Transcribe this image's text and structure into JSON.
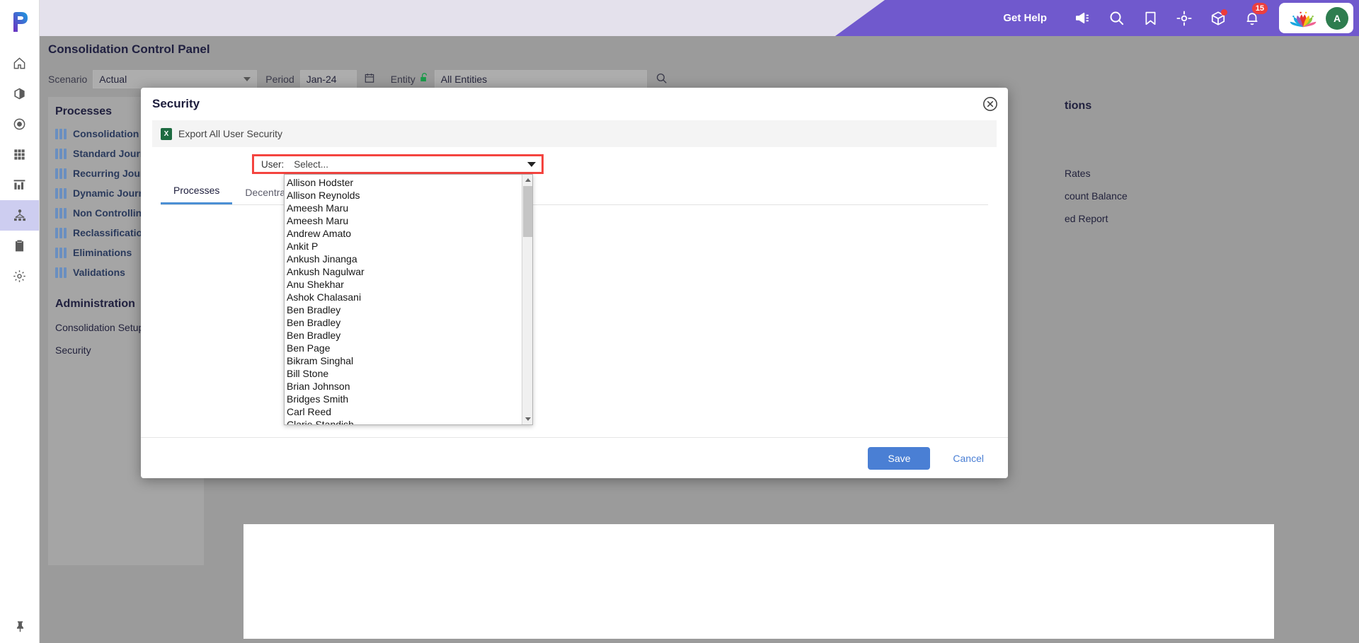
{
  "app": {
    "logo": "p-logo",
    "accent_purple": "#7059cd",
    "accent_blue": "#4a7fd4",
    "highlight_red": "#f4443f"
  },
  "rail": {
    "items": [
      {
        "icon": "home-icon",
        "name": "home",
        "active": false
      },
      {
        "icon": "cube-icon",
        "name": "models",
        "active": false
      },
      {
        "icon": "target-circle-icon",
        "name": "targets",
        "active": false
      },
      {
        "icon": "grid-icon",
        "name": "grid",
        "active": false
      },
      {
        "icon": "bar-chart-icon",
        "name": "reports",
        "active": false
      },
      {
        "icon": "hierarchy-icon",
        "name": "consolidation",
        "active": true
      },
      {
        "icon": "clipboard-check-icon",
        "name": "tasks",
        "active": false
      },
      {
        "icon": "gear-icon",
        "name": "settings",
        "active": false
      }
    ],
    "pin": "pin-icon"
  },
  "topbar": {
    "get_help": "Get Help",
    "icons": [
      {
        "name": "megaphone-icon",
        "badge": null,
        "dot": false
      },
      {
        "name": "search-icon",
        "badge": null,
        "dot": false
      },
      {
        "name": "bookmark-icon",
        "badge": null,
        "dot": false
      },
      {
        "name": "crosshair-icon",
        "badge": null,
        "dot": false
      },
      {
        "name": "box-icon",
        "badge": null,
        "dot": true
      },
      {
        "name": "bell-icon",
        "badge": "15",
        "dot": false
      }
    ],
    "brand_logo": "lotus-logo",
    "avatar_initial": "A"
  },
  "page": {
    "title": "Consolidation Control Panel",
    "filters": {
      "scenario_label": "Scenario",
      "scenario_value": "Actual",
      "period_label": "Period",
      "period_value": "Jan-24",
      "period_icon": "calendar-icon",
      "entity_label": "Entity",
      "entity_lock_icon": "unlock-icon",
      "entity_value": "All Entities",
      "search_icon": "search-icon"
    },
    "left_panel": {
      "processes_heading": "Processes",
      "processes": [
        "Consolidation Pro",
        "Standard Journal",
        "Recurring Journa",
        "Dynamic Journals",
        "Non Controlling",
        "Reclassifications",
        "Eliminations",
        "Validations"
      ],
      "administration_heading": "Administration",
      "administration": [
        "Consolidation Setup",
        "Security"
      ]
    },
    "right_panel": {
      "heading": "tions",
      "items": [
        "Rates",
        "count Balance",
        "ed Report"
      ]
    }
  },
  "modal": {
    "title": "Security",
    "close_icon": "close-icon",
    "export": {
      "icon": "excel-icon",
      "icon_text": "X",
      "label": "Export All User Security"
    },
    "user_field": {
      "label": "User:",
      "value": "Select...",
      "caret_icon": "chevron-down-icon"
    },
    "tabs": [
      {
        "label": "Processes",
        "active": true
      },
      {
        "label": "Decentralize",
        "active": false
      }
    ],
    "dropdown": {
      "options": [
        "Allison Hodster",
        "Allison Reynolds",
        "Ameesh Maru",
        "Ameesh Maru",
        "Andrew Amato",
        "Ankit P",
        "Ankush Jinanga",
        "Ankush Nagulwar",
        "Anu Shekhar",
        "Ashok Chalasani",
        "Ben Bradley",
        "Ben Bradley",
        "Ben Bradley",
        "Ben Page",
        "Bikram Singhal",
        "Bill Stone",
        "Brian Johnson",
        "Bridges Smith",
        "Carl Reed",
        "Clarie Standish"
      ],
      "scroll_up_icon": "scroll-up-arrow-icon",
      "scroll_down_icon": "scroll-down-arrow-icon"
    },
    "footer": {
      "save_label": "Save",
      "cancel_label": "Cancel"
    }
  }
}
